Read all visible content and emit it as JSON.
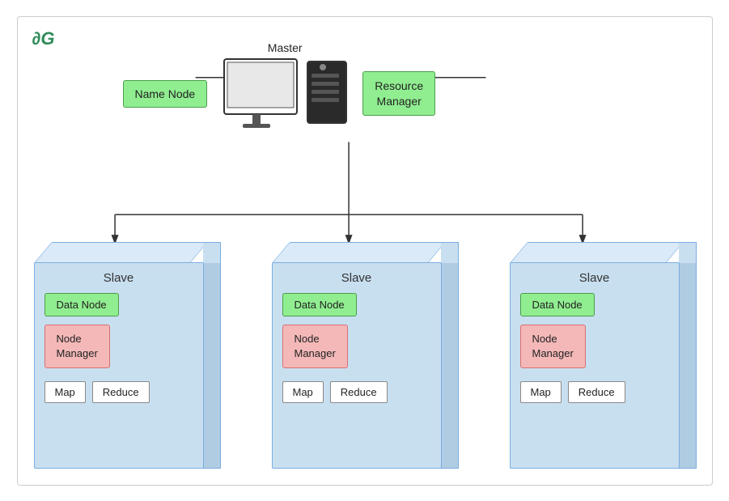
{
  "logo": {
    "text": "∂G"
  },
  "master": {
    "label": "Master",
    "name_node": "Name Node",
    "resource_manager": "Resource\nManager"
  },
  "slaves": [
    {
      "title": "Slave",
      "data_node": "Data Node",
      "node_manager": "Node\nManager",
      "map": "Map",
      "reduce": "Reduce"
    },
    {
      "title": "Slave",
      "data_node": "Data Node",
      "node_manager": "Node\nManager",
      "map": "Map",
      "reduce": "Reduce"
    },
    {
      "title": "Slave",
      "data_node": "Data Node",
      "node_manager": "Node\nManager",
      "map": "Map",
      "reduce": "Reduce"
    }
  ],
  "colors": {
    "green_box_bg": "#90ee90",
    "green_box_border": "#4a9e4a",
    "red_box_bg": "#f4b8b8",
    "red_box_border": "#d97070",
    "cube_front": "#c8dff0",
    "cube_border": "#7aade0"
  }
}
